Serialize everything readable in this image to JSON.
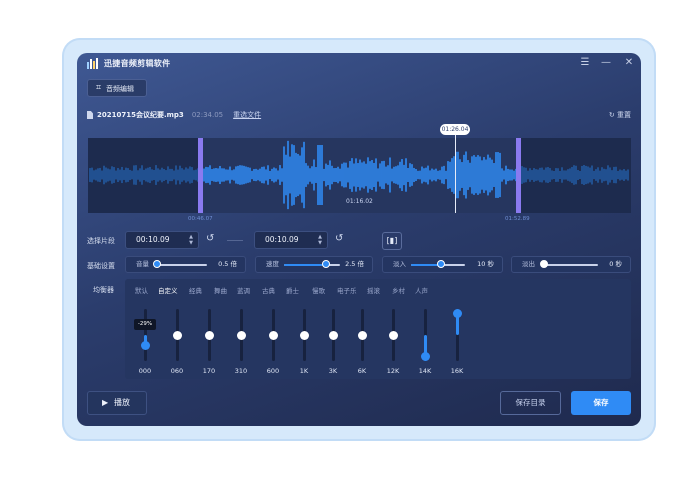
{
  "app": {
    "title": "迅捷音频剪辑软件",
    "logo_icon": "app-logo-icon"
  },
  "window_controls": {
    "menu": "☰",
    "minimize": "—",
    "close": "✕"
  },
  "toolbar": {
    "edit_label": "音频编辑",
    "edit_icon": "crop-icon"
  },
  "file": {
    "name": "20210715会议纪要.mp3",
    "duration": "02:34.05",
    "reselect_label": "重选文件",
    "reset_label": "重置"
  },
  "waveform": {
    "playhead_time": "01:26.04",
    "start_time": "00:46.07",
    "end_time": "01:52.89",
    "center_time": "01:16.02",
    "selection_start_fraction": 0.208,
    "selection_end_fraction": 0.792,
    "playhead_fraction": 0.676,
    "colors": {
      "wave": "#2f8bf5",
      "handle": "#8a7af0"
    }
  },
  "segment": {
    "label": "选择片段",
    "start": "00:10.09",
    "end": "00:10.09"
  },
  "basic": {
    "label": "基础设置",
    "volume": {
      "label": "音量",
      "value": "0.5 倍",
      "level": 0.0
    },
    "speed": {
      "label": "速度",
      "value": "2.5 倍",
      "level": 0.75
    },
    "fade_in": {
      "label": "淡入",
      "value": "10 秒",
      "level": 0.55
    },
    "fade_out": {
      "label": "淡出",
      "value": "0 秒",
      "level": 0.0
    }
  },
  "equalizer": {
    "label": "均衡器",
    "presets": [
      "默认",
      "自定义",
      "经典",
      "舞曲",
      "蓝调",
      "古典",
      "爵士",
      "慢歌",
      "电子乐",
      "摇滚",
      "乡村",
      "人声"
    ],
    "active_preset": "自定义",
    "bands": [
      {
        "label": "000",
        "level": 0.25,
        "tip": "-29%"
      },
      {
        "label": "060",
        "level": 0.5
      },
      {
        "label": "170",
        "level": 0.5
      },
      {
        "label": "310",
        "level": 0.5
      },
      {
        "label": "600",
        "level": 0.5
      },
      {
        "label": "1K",
        "level": 0.5
      },
      {
        "label": "3K",
        "level": 0.5
      },
      {
        "label": "6K",
        "level": 0.5
      },
      {
        "label": "12K",
        "level": 0.5
      },
      {
        "label": "14K",
        "level": 0.0
      },
      {
        "label": "16K",
        "level": 1.0
      }
    ]
  },
  "footer": {
    "play_label": "播放",
    "save_dir_label": "保存目录",
    "save_label": "保存"
  }
}
